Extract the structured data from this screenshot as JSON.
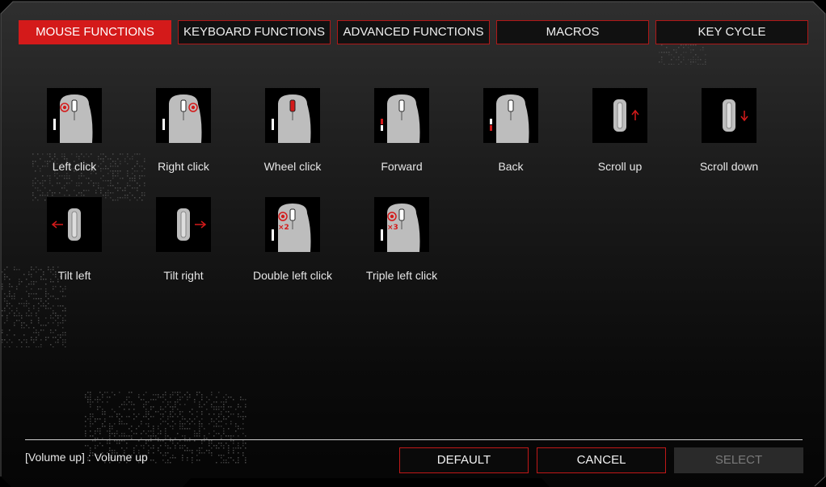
{
  "tabs": [
    {
      "label": "MOUSE FUNCTIONS",
      "active": true
    },
    {
      "label": "KEYBOARD FUNCTIONS",
      "active": false
    },
    {
      "label": "ADVANCED FUNCTIONS",
      "active": false
    },
    {
      "label": "MACROS",
      "active": false
    },
    {
      "label": "KEY CYCLE",
      "active": false
    }
  ],
  "functions": [
    {
      "label": "Left click",
      "icon": "mouse-left-click-icon"
    },
    {
      "label": "Right click",
      "icon": "mouse-right-click-icon"
    },
    {
      "label": "Wheel click",
      "icon": "mouse-wheel-click-icon"
    },
    {
      "label": "Forward",
      "icon": "mouse-forward-icon"
    },
    {
      "label": "Back",
      "icon": "mouse-back-icon"
    },
    {
      "label": "Scroll up",
      "icon": "scroll-up-icon"
    },
    {
      "label": "Scroll down",
      "icon": "scroll-down-icon"
    },
    {
      "label": "Tilt left",
      "icon": "tilt-left-icon"
    },
    {
      "label": "Tilt right",
      "icon": "tilt-right-icon"
    },
    {
      "label": "Double left click",
      "icon": "double-left-click-icon",
      "badge": "×2"
    },
    {
      "label": "Triple left click",
      "icon": "triple-left-click-icon",
      "badge": "×3"
    }
  ],
  "status": {
    "text": "[Volume up] : Volume up"
  },
  "buttons": {
    "default": "DEFAULT",
    "cancel": "CANCEL",
    "select": "SELECT"
  },
  "colors": {
    "accent": "#d41a1a",
    "background": "#1a1a1a",
    "text": "#e6e6e6"
  }
}
